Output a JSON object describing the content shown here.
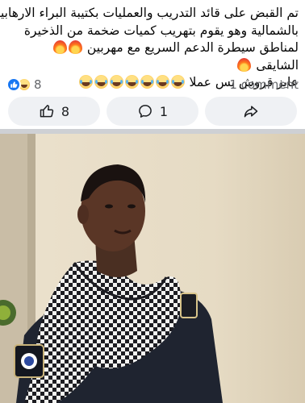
{
  "post": {
    "lines": [
      "تم القبض على قائد التدريب والعمليات بكتيبة البراء الارهابية",
      "بالشمالية وهو يقوم بتهريب كميات ضخمة من الذخيرة",
      "لمناطق سيطرة الدعم السريع مع مهربين",
      "الشايقى",
      "عايز قروش بس عملا"
    ]
  },
  "reactions": {
    "count": "8",
    "icons": [
      "like-reaction",
      "haha-reaction"
    ]
  },
  "comments": {
    "count_label": "1 comment"
  },
  "actions": {
    "like_count": "8",
    "comment_count": "1"
  },
  "emoji": {
    "fire": "fire-emoji",
    "laugh": "face-with-tears-of-joy-emoji"
  },
  "colors": {
    "accent": "#1877f2",
    "action_bg": "#eff1f4",
    "divider": "#ced0d4"
  }
}
